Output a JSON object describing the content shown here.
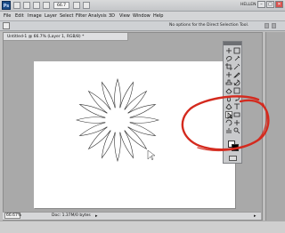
{
  "titlebar": {
    "logo": "Ps",
    "zoom": "66.7",
    "workspace": "HELLEN",
    "window_buttons": [
      "–",
      "□",
      "✕"
    ]
  },
  "menubar": {
    "items": [
      "File",
      "Edit",
      "Image",
      "Layer",
      "Select",
      "Filter",
      "Analysis",
      "3D",
      "View",
      "Window",
      "Help"
    ]
  },
  "options_bar": {
    "message": "No options for the Direct Selection Tool."
  },
  "document": {
    "tab_title": "Untitled-1 @ 66.7% (Layer 1, RGB/8) *",
    "canvas_color": "#ffffff",
    "status_zoom": "66.67%",
    "status_doc": "Doc: 1.37M/0 bytes"
  },
  "toolbox": {
    "tools": [
      "move-tool",
      "marquee-tool",
      "lasso-tool",
      "quick-selection-tool",
      "crop-tool",
      "eyedropper-tool",
      "spot-healing-tool",
      "brush-tool",
      "clone-stamp-tool",
      "history-brush-tool",
      "eraser-tool",
      "gradient-tool",
      "blur-tool",
      "dodge-tool",
      "pen-tool",
      "type-tool",
      "direct-selection-tool",
      "shape-tool",
      "3d-rotate-tool",
      "3d-orbit-tool",
      "hand-tool",
      "zoom-tool"
    ],
    "active_tool": "direct-selection-tool",
    "foreground": "#ffffff",
    "background": "#000000"
  },
  "colors": {
    "annotation": "#d42a1e",
    "app_chrome": "#d4d5d7",
    "pasteboard": "#a9a9a9"
  }
}
